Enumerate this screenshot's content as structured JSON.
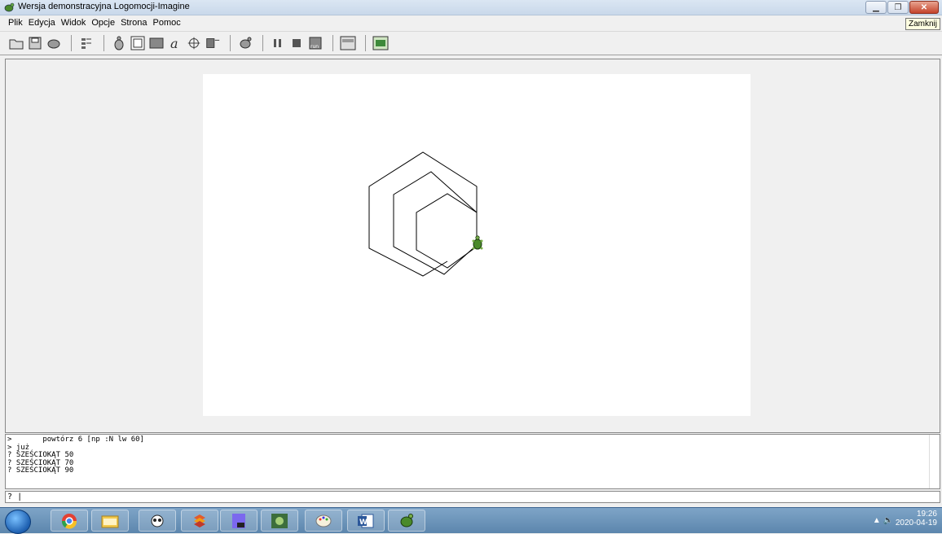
{
  "window": {
    "title": "Wersja demonstracyjna Logomocji-Imagine",
    "tooltip": "Zamknij"
  },
  "menu": [
    "Plik",
    "Edycja",
    "Widok",
    "Opcje",
    "Strona",
    "Pomoc"
  ],
  "toolbar": {
    "groups": [
      [
        "open-folder-icon",
        "save-icon",
        "turtle-settings-icon"
      ],
      [
        "list-icon"
      ],
      [
        "turtle-icon",
        "window-icon",
        "gray-rect-icon",
        "text-icon",
        "target-icon",
        "editor-icon"
      ],
      [
        "turtle-new-icon"
      ],
      [
        "pause-icon",
        "stop-icon",
        "run-icon"
      ],
      [
        "page-icon"
      ],
      [
        "image-icon"
      ]
    ]
  },
  "history": {
    "lines": [
      ">       powtórz 6 [np :N lw 60]",
      "> już",
      "? SZEŚCIOKĄT 50",
      "? SZEŚCIOKĄT 70",
      "? SZEŚCIOKĄT 90"
    ]
  },
  "commandline": {
    "prompt": "?"
  },
  "taskbar": {
    "time": "19:26",
    "date": "2020-04-19",
    "apps": [
      "chrome-icon",
      "explorer-icon",
      "panda-icon",
      "stack-icon",
      "math-book-icon",
      "game-icon",
      "paint-icon",
      "word-icon",
      "logo-turtle-icon"
    ]
  },
  "drawing": {
    "hexagon_sizes": [
      50,
      70,
      90
    ],
    "turn_angle": 60
  }
}
